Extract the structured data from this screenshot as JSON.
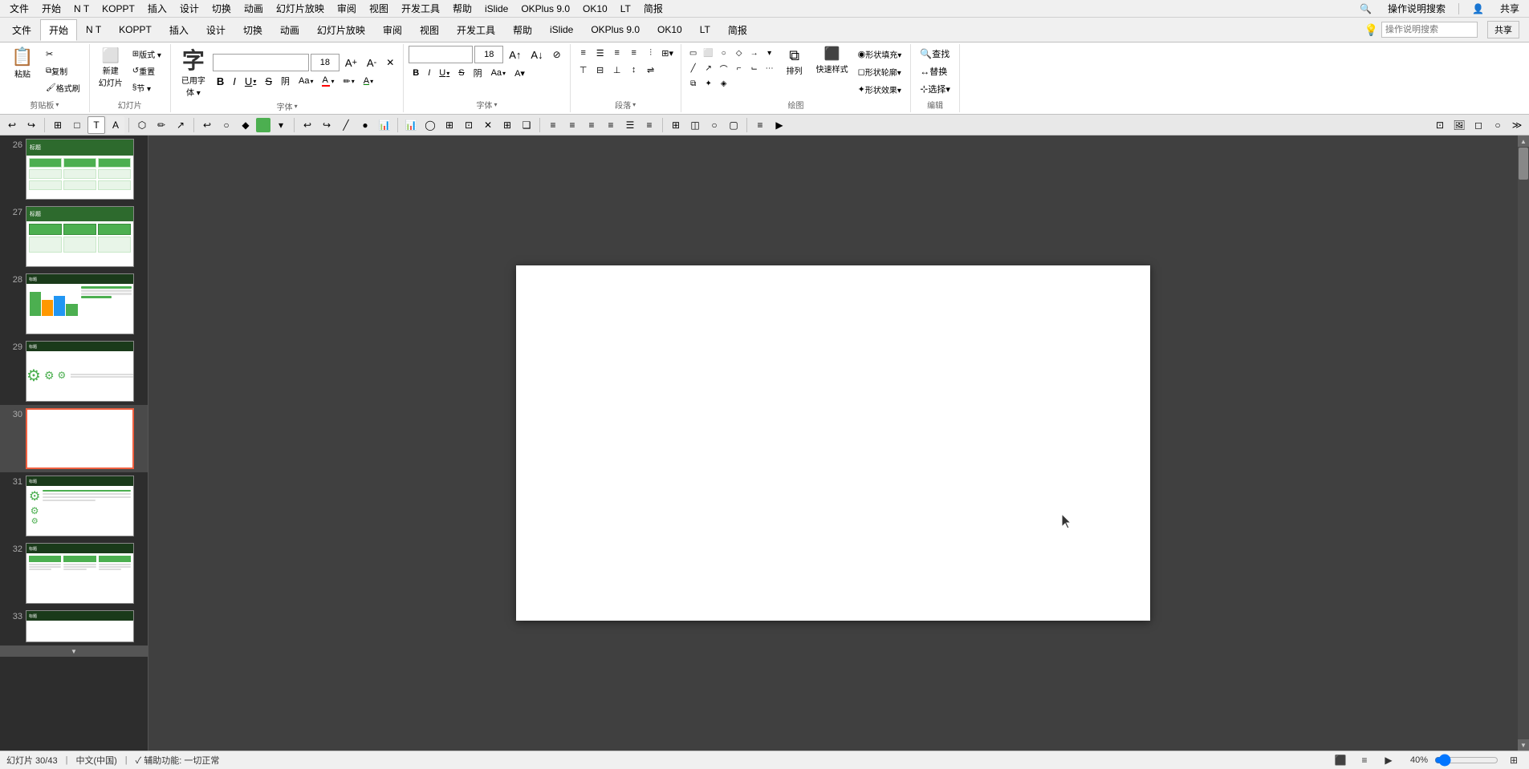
{
  "menu": {
    "items": [
      "文件",
      "开始",
      "N T",
      "KOPPT",
      "插入",
      "设计",
      "切换",
      "动画",
      "幻灯片放映",
      "审阅",
      "视图",
      "开发工具",
      "帮助",
      "iSlide",
      "OKPlus 9.0",
      "OK10",
      "LT",
      "简报",
      "🔍",
      "操作说明搜索",
      "共享"
    ]
  },
  "ribbon": {
    "active_tab": "开始",
    "tabs": [
      "文件",
      "开始",
      "N T",
      "KOPPT",
      "插入",
      "设计",
      "切换",
      "动画",
      "幻灯片放映",
      "审阅",
      "视图",
      "开发工具",
      "帮助",
      "iSlide",
      "OKPlus 9.0",
      "OK10",
      "LT",
      "简报"
    ],
    "search_placeholder": "操作说明搜索",
    "share_label": "共享",
    "groups": {
      "clipboard": {
        "label": "剪贴板",
        "paste": "粘贴",
        "cut": "✂",
        "copy": "复制",
        "format_paint": "格式刷"
      },
      "slides": {
        "label": "幻灯片",
        "new": "新建幻灯片",
        "layout": "版式",
        "reset": "重置",
        "section": "节"
      },
      "font_group": {
        "label": "字体",
        "font_name": "已用字体",
        "font_size": "18",
        "grow": "A↑",
        "shrink": "A↓",
        "clear": "✕",
        "bold": "B",
        "italic": "I",
        "underline": "U",
        "strike": "S",
        "shadow": "阴",
        "spacing": "Aa",
        "color": "A"
      },
      "paragraph": {
        "label": "段落"
      },
      "drawing": {
        "label": "绘图"
      },
      "arrange": {
        "label": "排列"
      },
      "quick_style": {
        "label": "快速样式"
      },
      "edit": {
        "label": "编辑",
        "find": "查找",
        "replace": "替换",
        "select": "选择"
      },
      "shape_fill": "形状填充",
      "shape_outline": "形状轮廓",
      "shape_effect": "形状效果"
    }
  },
  "toolbar2": {
    "buttons": [
      "≡",
      "⊞",
      "□",
      "T",
      "A",
      "↔",
      "✏",
      "↗",
      "↩",
      "○",
      "■",
      "◆",
      "↕",
      "↱",
      "↻",
      "≡",
      "≡",
      "≡",
      "A",
      "◯",
      "◈",
      "◰",
      "▶",
      "◉",
      "⊡",
      "✕",
      "⊞",
      "❑",
      "≡",
      "≡",
      "≡",
      "≡",
      "☰",
      "≡",
      "≡",
      "≡",
      "⊞",
      "◫",
      "○",
      "▢",
      "≡",
      "▷"
    ]
  },
  "slides": [
    {
      "number": "26",
      "type": "green_header_table"
    },
    {
      "number": "27",
      "type": "green_header_grid"
    },
    {
      "number": "28",
      "type": "chart"
    },
    {
      "number": "29",
      "type": "gears"
    },
    {
      "number": "30",
      "type": "blank",
      "active": true
    },
    {
      "number": "31",
      "type": "gears_text"
    },
    {
      "number": "32",
      "type": "columns"
    },
    {
      "number": "33",
      "type": "partial"
    }
  ],
  "canvas": {
    "current_slide": 30,
    "is_blank": true
  },
  "bottom_bar": {
    "slide_info": "幻灯片 30/43",
    "language": "中文(中国)",
    "accessibility": "✓ 辅助功能: 一切正常",
    "view_normal": "■",
    "view_outline": "≡",
    "view_slideshow": "▶",
    "zoom": "40%",
    "zoom_fit": "⊞"
  }
}
